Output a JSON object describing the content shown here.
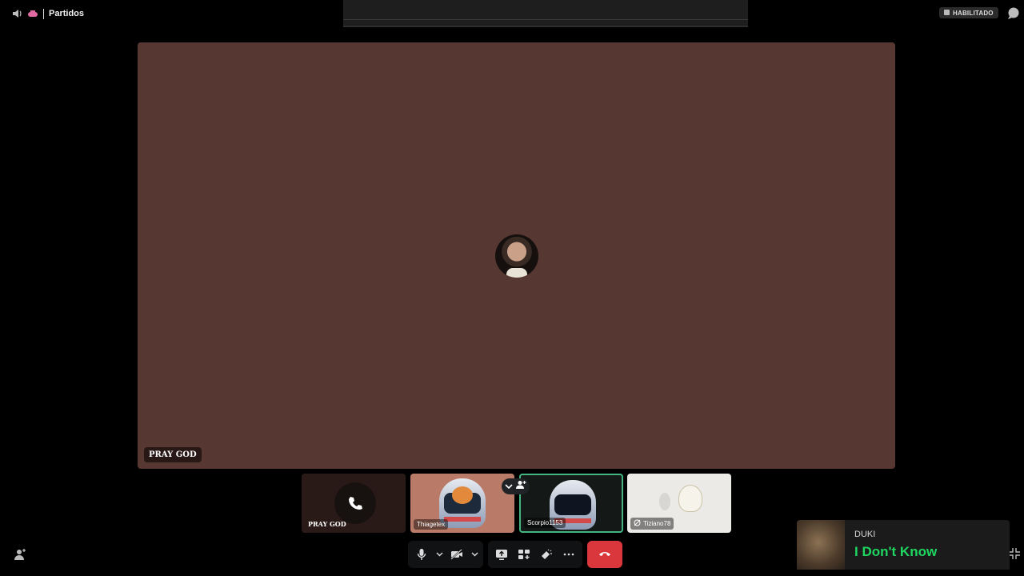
{
  "header": {
    "channel_name": "Partidos",
    "status_badge": "HABILITADO"
  },
  "stage": {
    "speaker_label": "PRAY GOD"
  },
  "participants": [
    {
      "name": "PRAY GOD"
    },
    {
      "name": "Thiagetex"
    },
    {
      "name": "Scorpio1153"
    },
    {
      "name": "Tiziano78"
    }
  ],
  "now_playing": {
    "artist": "DUKI",
    "title": "I Don't Know"
  },
  "colors": {
    "stage_bg": "#573731",
    "hangup": "#da373c",
    "speaking_border": "#43b581",
    "music_title": "#1ed760"
  }
}
